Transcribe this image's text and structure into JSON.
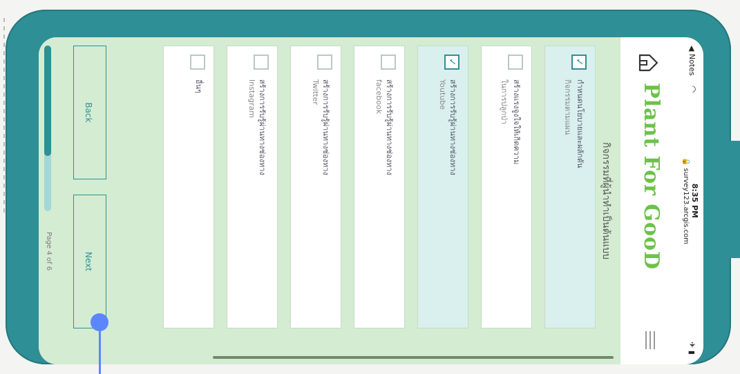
{
  "status_bar": {
    "notes": "◀ Notes",
    "time": "8:35 PM",
    "url": "🔒 survey123.arcgis.com",
    "battery": "✈ ▮"
  },
  "header": {
    "logo": "Plant For GooD",
    "home_icon": "home-icon",
    "menu_icon": "hamburger-menu-icon"
  },
  "question": {
    "title": "กิจกรรมที่ผู้นำทำเป็นต้นแบบ"
  },
  "options": [
    {
      "line1": "กำหนดนโยบายและผลักดัน",
      "line2": "กิจกรรมตามแผน",
      "checked": true
    },
    {
      "line1": "สร้างแรงจูงใจให้เกิดความ",
      "line2": "ในการปลูกป่า",
      "checked": false
    },
    {
      "line1": "สร้างการรับรู้ผ่านทางช่องทาง",
      "line2": "Youtube",
      "checked": true
    },
    {
      "line1": "สร้างการรับรู้ผ่านทางช่องทาง",
      "line2": "facebook",
      "checked": false
    },
    {
      "line1": "สร้างการรับรู้ผ่านทางช่องทาง",
      "line2": "Twitter",
      "checked": false
    },
    {
      "line1": "สร้างการรับรู้ผ่านทางช่องทาง",
      "line2": "Instagram",
      "checked": false
    },
    {
      "line1": "อื่นๆ",
      "line2": "",
      "checked": false
    }
  ],
  "nav": {
    "back_label": "Back",
    "next_label": "Next"
  },
  "progress": {
    "page_label": "Page 4 of 6",
    "fraction": 0.6667
  },
  "colors": {
    "frame": "#2e8f96",
    "content_bg": "#d4ecd2",
    "selected_bg": "#d9f0ef",
    "logo": "#6cc24a",
    "pointer": "#5b86ff"
  }
}
